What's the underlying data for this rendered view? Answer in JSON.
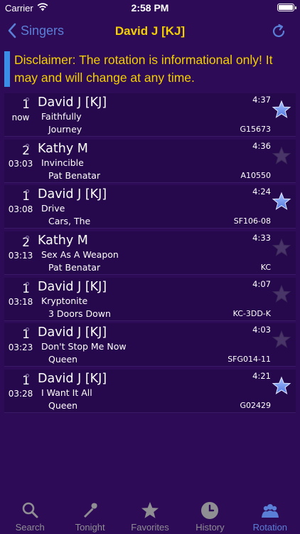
{
  "status_bar": {
    "carrier": "Carrier",
    "time": "2:58 PM"
  },
  "nav": {
    "back_label": "Singers",
    "title": "David J [KJ]"
  },
  "disclaimer": "Disclaimer: The rotation is informational only! It may and will change at any time.",
  "rotation": [
    {
      "position": "1",
      "wait": "now",
      "singer": "David J [KJ]",
      "song": "Faithfully",
      "artist": "Journey",
      "duration": "4:37",
      "code": "G15673",
      "favorite": true
    },
    {
      "position": "2",
      "wait": "03:03",
      "singer": "Kathy M",
      "song": "Invincible",
      "artist": "Pat Benatar",
      "duration": "4:36",
      "code": "A10550",
      "favorite": false
    },
    {
      "position": "1",
      "wait": "03:08",
      "singer": "David J [KJ]",
      "song": "Drive",
      "artist": "Cars, The",
      "duration": "4:24",
      "code": "SF106-08",
      "favorite": true
    },
    {
      "position": "2",
      "wait": "03:13",
      "singer": "Kathy M",
      "song": "Sex As A Weapon",
      "artist": "Pat Benatar",
      "duration": "4:33",
      "code": "KC",
      "favorite": false
    },
    {
      "position": "1",
      "wait": "03:18",
      "singer": "David J [KJ]",
      "song": "Kryptonite",
      "artist": "3 Doors Down",
      "duration": "4:07",
      "code": "KC-3DD-K",
      "favorite": false
    },
    {
      "position": "1",
      "wait": "03:23",
      "singer": "David J [KJ]",
      "song": "Don't Stop Me Now",
      "artist": "Queen",
      "duration": "4:03",
      "code": "SFG014-11",
      "favorite": false
    },
    {
      "position": "1",
      "wait": "03:28",
      "singer": "David J [KJ]",
      "song": "I Want It All",
      "artist": "Queen",
      "duration": "4:21",
      "code": "G02429",
      "favorite": true
    }
  ],
  "tabs": [
    {
      "label": "Search",
      "icon": "search-icon",
      "active": false
    },
    {
      "label": "Tonight",
      "icon": "microphone-icon",
      "active": false
    },
    {
      "label": "Favorites",
      "icon": "star-icon",
      "active": false
    },
    {
      "label": "History",
      "icon": "clock-icon",
      "active": false
    },
    {
      "label": "Rotation",
      "icon": "people-icon",
      "active": true
    }
  ],
  "colors": {
    "background": "#2e0b57",
    "row_background": "#26084c",
    "accent_yellow": "#f4d000",
    "accent_blue": "#5a7fd6",
    "disclaimer_bar": "#3b8ee6",
    "star_on": "#6f93f0",
    "star_off": "#4a3568",
    "tab_inactive": "#8e8e93"
  }
}
